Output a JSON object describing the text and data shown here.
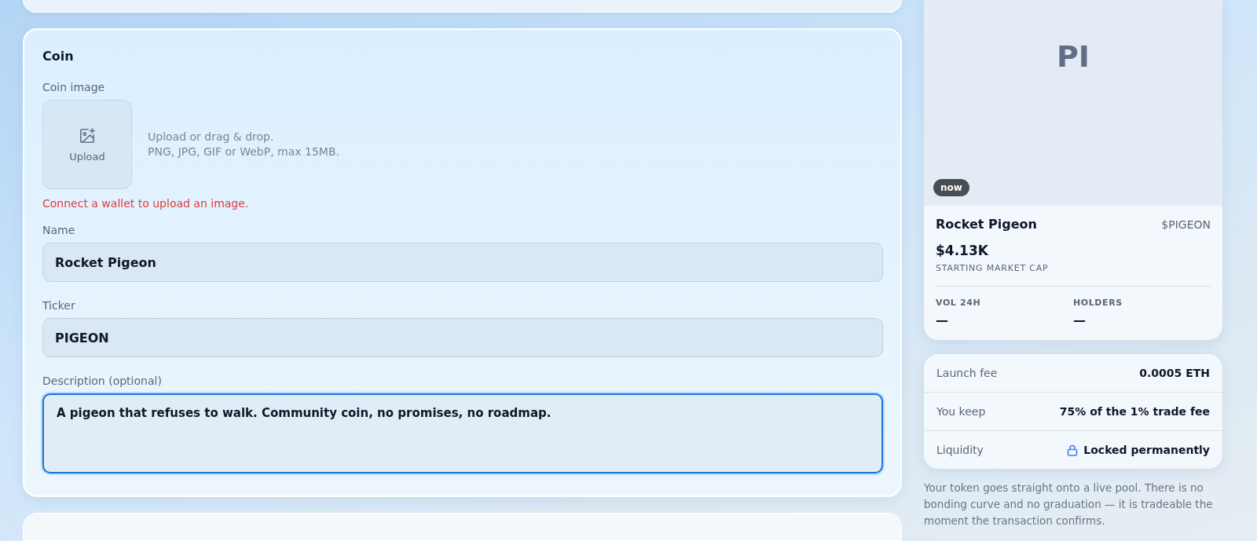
{
  "coin_card": {
    "title": "Coin",
    "image_label": "Coin image",
    "upload_button": "Upload",
    "upload_hint": [
      "Upload or drag & drop.",
      "PNG, JPG, GIF or WebP, max 15MB."
    ],
    "error": "Connect a wallet to upload an image.",
    "fields": [
      {
        "label": "Name",
        "value": "Rocket Pigeon",
        "kind": "input",
        "focused": false
      },
      {
        "label": "Ticker",
        "value": "PIGEON",
        "kind": "input",
        "focused": false
      },
      {
        "label": "Description (optional)",
        "value": "A pigeon that refuses to walk. Community coin, no promises, no roadmap.",
        "kind": "textarea",
        "focused": true
      }
    ]
  },
  "preview": {
    "initials": "PI",
    "badge": "now",
    "name": "Rocket Pigeon",
    "ticker": "$PIGEON",
    "market_cap": "$4.13K",
    "market_cap_label": "STARTING MARKET CAP",
    "stats": [
      {
        "label": "VOL 24H",
        "value": "—"
      },
      {
        "label": "HOLDERS",
        "value": "—"
      }
    ]
  },
  "fees": [
    {
      "label": "Launch fee",
      "value": "0.0005 ETH",
      "kind": "text"
    },
    {
      "label": "You keep",
      "value": "75% of the 1% trade fee",
      "kind": "text"
    },
    {
      "label": "Liquidity",
      "value": "Locked permanently",
      "kind": "locked"
    }
  ],
  "note": "Your token goes straight onto a live pool. There is no bonding curve and no graduation — it is tradeable the moment the transaction confirms."
}
